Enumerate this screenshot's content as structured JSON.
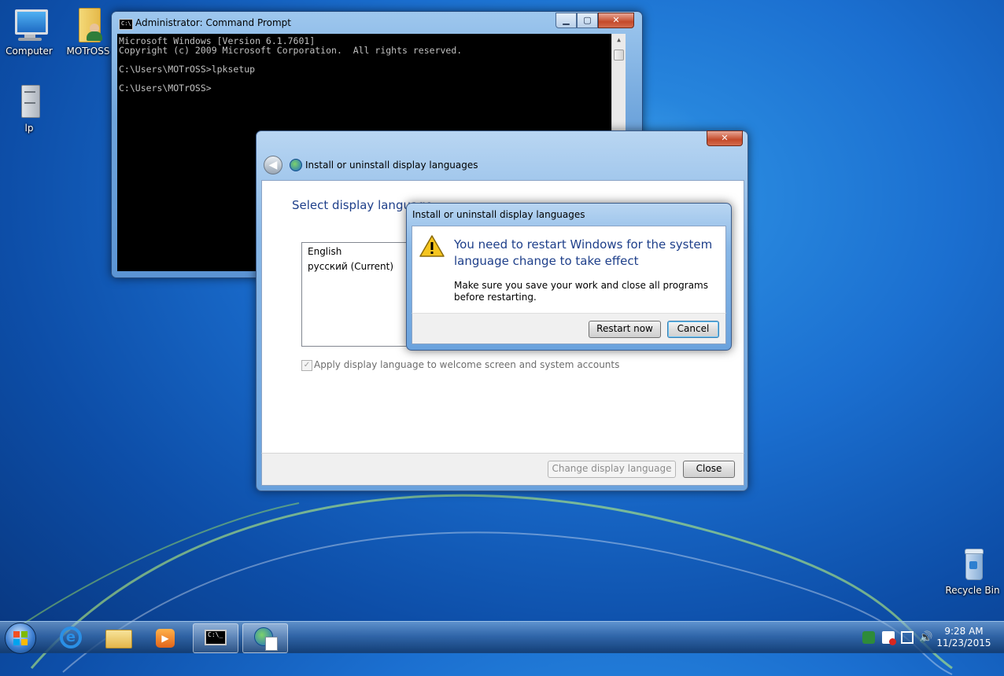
{
  "desktop": {
    "icons": [
      {
        "label": "Computer"
      },
      {
        "label": "MOTrOSS"
      },
      {
        "label": "lp"
      },
      {
        "label": "Recycle Bin"
      }
    ]
  },
  "cmd": {
    "title": "Administrator: Command Prompt",
    "lines": [
      "Microsoft Windows [Version 6.1.7601]",
      "Copyright (c) 2009 Microsoft Corporation.  All rights reserved.",
      "",
      "C:\\Users\\MOTrOSS>lpksetup",
      "",
      "C:\\Users\\MOTrOSS>"
    ]
  },
  "lang_dialog": {
    "title": "Install or uninstall display languages",
    "heading": "Select display language",
    "languages": [
      "English",
      "русский (Current)"
    ],
    "checkbox_label": "Apply display language to welcome screen and system accounts",
    "checkbox_checked": true,
    "change_button": "Change display language",
    "close_button": "Close"
  },
  "restart_modal": {
    "title": "Install or uninstall display languages",
    "main_instruction": "You need to restart Windows for the system language change to take effect",
    "content": "Make sure you save your work and close all programs before restarting.",
    "restart_button": "Restart now",
    "cancel_button": "Cancel"
  },
  "taskbar": {
    "time": "9:28 AM",
    "date": "11/23/2015"
  }
}
